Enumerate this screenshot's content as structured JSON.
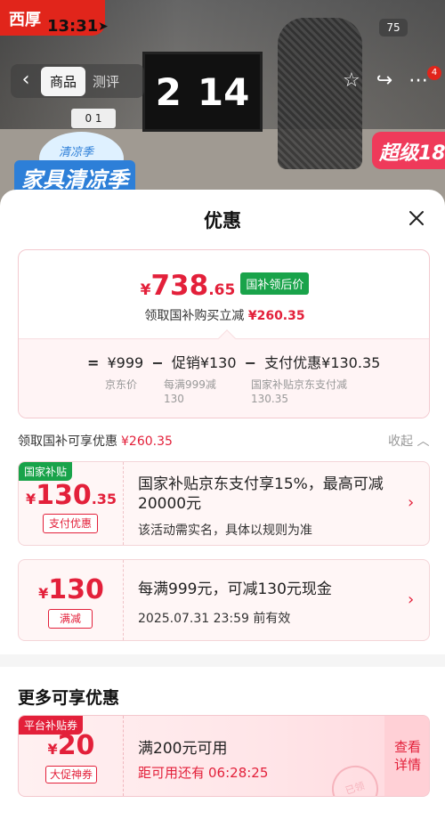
{
  "status_bar": {
    "time": "13:31",
    "battery": "75"
  },
  "background": {
    "app_logo": "西厚",
    "tabs": [
      "商品",
      "测评"
    ],
    "monitor_digits": [
      "2",
      "14"
    ],
    "clock_text": "0 1",
    "promo_small": "清凉季",
    "promo_big": "家具清凉季",
    "super_badge": "超级18",
    "more_badge_count": "4"
  },
  "sheet": {
    "title": "优惠",
    "summary": {
      "currency": "¥",
      "price_int": "738",
      "price_dec": ".65",
      "price_tag": "国补领后价",
      "reduce_text": "领取国补购买立减",
      "reduce_amount": "¥260.35",
      "formula": {
        "eq": "=",
        "base": "¥999",
        "minus1": "−",
        "promo": "促销¥130",
        "minus2": "−",
        "pay": "支付优惠¥130.35",
        "cap_base": "京东价",
        "cap_promo_1": "每满999减",
        "cap_promo_2": "130",
        "cap_pay_1": "国家补贴京东支付减",
        "cap_pay_2": "130.35"
      }
    },
    "section_label": "领取国补可享优惠",
    "section_amount": "¥260.35",
    "collapse_label": "收起",
    "coupons": [
      {
        "flag": "国家补贴",
        "currency": "¥",
        "amount_int": "130",
        "amount_dec": ".35",
        "kind": "支付优惠",
        "title_line1": "国家补贴京东支付享15%，最高可减",
        "title_line2": "20000元",
        "subtitle": "该活动需实名，具体以规则为准"
      },
      {
        "currency": "¥",
        "amount_int": "130",
        "kind": "满减",
        "title_line1": "每满999元，可减130元现金",
        "subtitle": "2025.07.31 23:59 前有效"
      }
    ],
    "more_title": "更多可享优惠",
    "platform_coupon": {
      "flag": "平台补贴券",
      "currency": "¥",
      "amount_int": "20",
      "kind": "大促神券",
      "title": "满200元可用",
      "countdown_label": "距可用还有",
      "countdown": "06:28:25",
      "stamp": "已领",
      "side_line1": "查看",
      "side_line2": "详情"
    }
  },
  "colors": {
    "accent": "#e3203a",
    "green": "#19a34a",
    "brand": "#e1251b"
  }
}
